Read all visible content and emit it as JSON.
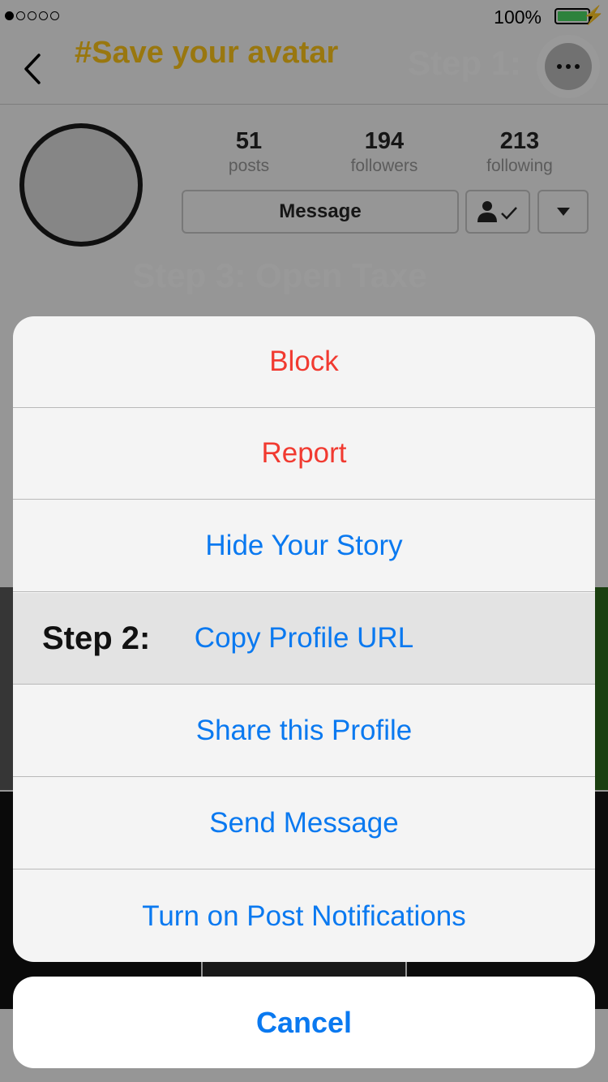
{
  "status_bar": {
    "battery_percent": "100%",
    "signal_dots": 5,
    "signal_active": 1
  },
  "nav": {
    "caption": "#Save your avatar",
    "step1_label": "Step 1:",
    "back_icon": "chevron-left-icon",
    "more_icon": "ellipsis-icon"
  },
  "profile": {
    "stats": [
      {
        "value": "51",
        "label": "posts"
      },
      {
        "value": "194",
        "label": "followers"
      },
      {
        "value": "213",
        "label": "following"
      }
    ],
    "message_button": "Message",
    "step3_label": "Step 3: Open Taxe"
  },
  "action_sheet": {
    "items": [
      {
        "label": "Block"
      },
      {
        "label": "Report"
      },
      {
        "label": "Hide Your Story"
      },
      {
        "label": "Copy Profile URL"
      },
      {
        "label": "Share this Profile"
      },
      {
        "label": "Send Message"
      },
      {
        "label": "Turn on Post Notifications"
      }
    ],
    "step2_label": "Step 2:",
    "cancel": "Cancel"
  },
  "colors": {
    "destructive": "#f13a30",
    "action": "#0a79f0",
    "caption": "#ffc61a",
    "battery": "#4cd964"
  }
}
